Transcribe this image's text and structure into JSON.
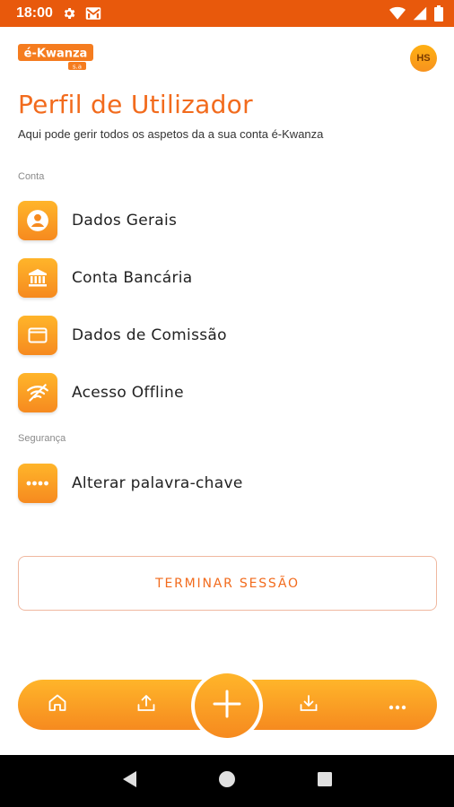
{
  "status_bar": {
    "time": "18:00",
    "icons": [
      "gear-icon",
      "gmail-icon",
      "wifi-icon",
      "signal-icon",
      "battery-icon"
    ]
  },
  "header": {
    "logo_text": "é-Kwanza",
    "logo_sub": "s.a",
    "avatar_initials": "HS"
  },
  "page": {
    "title": "Perfil de Utilizador",
    "subtitle": "Aqui pode gerir todos os aspetos da a sua conta é-Kwanza"
  },
  "sections": {
    "account_label": "Conta",
    "security_label": "Segurança"
  },
  "account_items": [
    {
      "label": "Dados Gerais",
      "icon": "user-circle-icon"
    },
    {
      "label": "Conta Bancária",
      "icon": "bank-icon"
    },
    {
      "label": "Dados de Comissão",
      "icon": "wallet-icon"
    },
    {
      "label": "Acesso Offline",
      "icon": "wifi-off-icon"
    }
  ],
  "security_items": [
    {
      "label": "Alterar palavra-chave",
      "icon": "password-icon"
    }
  ],
  "logout_label": "TERMINAR SESSÃO",
  "bottom_nav": {
    "items": [
      "home-icon",
      "upload-icon",
      "plus-icon",
      "download-icon",
      "more-icon"
    ]
  },
  "colors": {
    "accent": "#f26b1d",
    "status_bar": "#e8590c",
    "gradient_top": "#ffb52a",
    "gradient_bottom": "#f68a1f"
  }
}
